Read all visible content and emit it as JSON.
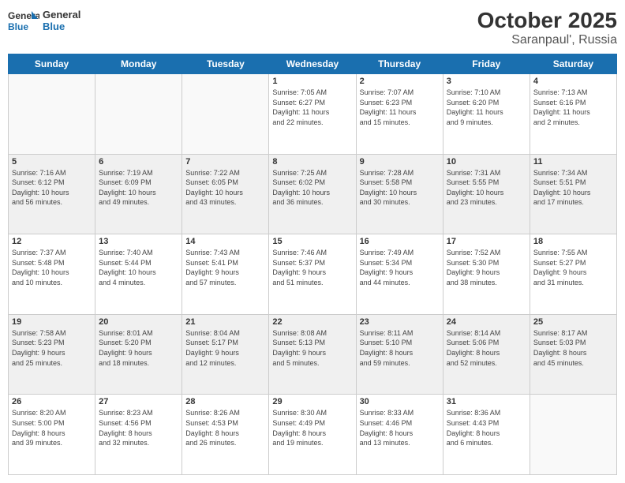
{
  "header": {
    "logo": {
      "line1": "General",
      "line2": "Blue"
    },
    "title": "October 2025",
    "location": "Saranpaul', Russia"
  },
  "weekdays": [
    "Sunday",
    "Monday",
    "Tuesday",
    "Wednesday",
    "Thursday",
    "Friday",
    "Saturday"
  ],
  "weeks": [
    [
      {
        "day": "",
        "info": ""
      },
      {
        "day": "",
        "info": ""
      },
      {
        "day": "",
        "info": ""
      },
      {
        "day": "1",
        "info": "Sunrise: 7:05 AM\nSunset: 6:27 PM\nDaylight: 11 hours\nand 22 minutes."
      },
      {
        "day": "2",
        "info": "Sunrise: 7:07 AM\nSunset: 6:23 PM\nDaylight: 11 hours\nand 15 minutes."
      },
      {
        "day": "3",
        "info": "Sunrise: 7:10 AM\nSunset: 6:20 PM\nDaylight: 11 hours\nand 9 minutes."
      },
      {
        "day": "4",
        "info": "Sunrise: 7:13 AM\nSunset: 6:16 PM\nDaylight: 11 hours\nand 2 minutes."
      }
    ],
    [
      {
        "day": "5",
        "info": "Sunrise: 7:16 AM\nSunset: 6:12 PM\nDaylight: 10 hours\nand 56 minutes."
      },
      {
        "day": "6",
        "info": "Sunrise: 7:19 AM\nSunset: 6:09 PM\nDaylight: 10 hours\nand 49 minutes."
      },
      {
        "day": "7",
        "info": "Sunrise: 7:22 AM\nSunset: 6:05 PM\nDaylight: 10 hours\nand 43 minutes."
      },
      {
        "day": "8",
        "info": "Sunrise: 7:25 AM\nSunset: 6:02 PM\nDaylight: 10 hours\nand 36 minutes."
      },
      {
        "day": "9",
        "info": "Sunrise: 7:28 AM\nSunset: 5:58 PM\nDaylight: 10 hours\nand 30 minutes."
      },
      {
        "day": "10",
        "info": "Sunrise: 7:31 AM\nSunset: 5:55 PM\nDaylight: 10 hours\nand 23 minutes."
      },
      {
        "day": "11",
        "info": "Sunrise: 7:34 AM\nSunset: 5:51 PM\nDaylight: 10 hours\nand 17 minutes."
      }
    ],
    [
      {
        "day": "12",
        "info": "Sunrise: 7:37 AM\nSunset: 5:48 PM\nDaylight: 10 hours\nand 10 minutes."
      },
      {
        "day": "13",
        "info": "Sunrise: 7:40 AM\nSunset: 5:44 PM\nDaylight: 10 hours\nand 4 minutes."
      },
      {
        "day": "14",
        "info": "Sunrise: 7:43 AM\nSunset: 5:41 PM\nDaylight: 9 hours\nand 57 minutes."
      },
      {
        "day": "15",
        "info": "Sunrise: 7:46 AM\nSunset: 5:37 PM\nDaylight: 9 hours\nand 51 minutes."
      },
      {
        "day": "16",
        "info": "Sunrise: 7:49 AM\nSunset: 5:34 PM\nDaylight: 9 hours\nand 44 minutes."
      },
      {
        "day": "17",
        "info": "Sunrise: 7:52 AM\nSunset: 5:30 PM\nDaylight: 9 hours\nand 38 minutes."
      },
      {
        "day": "18",
        "info": "Sunrise: 7:55 AM\nSunset: 5:27 PM\nDaylight: 9 hours\nand 31 minutes."
      }
    ],
    [
      {
        "day": "19",
        "info": "Sunrise: 7:58 AM\nSunset: 5:23 PM\nDaylight: 9 hours\nand 25 minutes."
      },
      {
        "day": "20",
        "info": "Sunrise: 8:01 AM\nSunset: 5:20 PM\nDaylight: 9 hours\nand 18 minutes."
      },
      {
        "day": "21",
        "info": "Sunrise: 8:04 AM\nSunset: 5:17 PM\nDaylight: 9 hours\nand 12 minutes."
      },
      {
        "day": "22",
        "info": "Sunrise: 8:08 AM\nSunset: 5:13 PM\nDaylight: 9 hours\nand 5 minutes."
      },
      {
        "day": "23",
        "info": "Sunrise: 8:11 AM\nSunset: 5:10 PM\nDaylight: 8 hours\nand 59 minutes."
      },
      {
        "day": "24",
        "info": "Sunrise: 8:14 AM\nSunset: 5:06 PM\nDaylight: 8 hours\nand 52 minutes."
      },
      {
        "day": "25",
        "info": "Sunrise: 8:17 AM\nSunset: 5:03 PM\nDaylight: 8 hours\nand 45 minutes."
      }
    ],
    [
      {
        "day": "26",
        "info": "Sunrise: 8:20 AM\nSunset: 5:00 PM\nDaylight: 8 hours\nand 39 minutes."
      },
      {
        "day": "27",
        "info": "Sunrise: 8:23 AM\nSunset: 4:56 PM\nDaylight: 8 hours\nand 32 minutes."
      },
      {
        "day": "28",
        "info": "Sunrise: 8:26 AM\nSunset: 4:53 PM\nDaylight: 8 hours\nand 26 minutes."
      },
      {
        "day": "29",
        "info": "Sunrise: 8:30 AM\nSunset: 4:49 PM\nDaylight: 8 hours\nand 19 minutes."
      },
      {
        "day": "30",
        "info": "Sunrise: 8:33 AM\nSunset: 4:46 PM\nDaylight: 8 hours\nand 13 minutes."
      },
      {
        "day": "31",
        "info": "Sunrise: 8:36 AM\nSunset: 4:43 PM\nDaylight: 8 hours\nand 6 minutes."
      },
      {
        "day": "",
        "info": ""
      }
    ]
  ]
}
